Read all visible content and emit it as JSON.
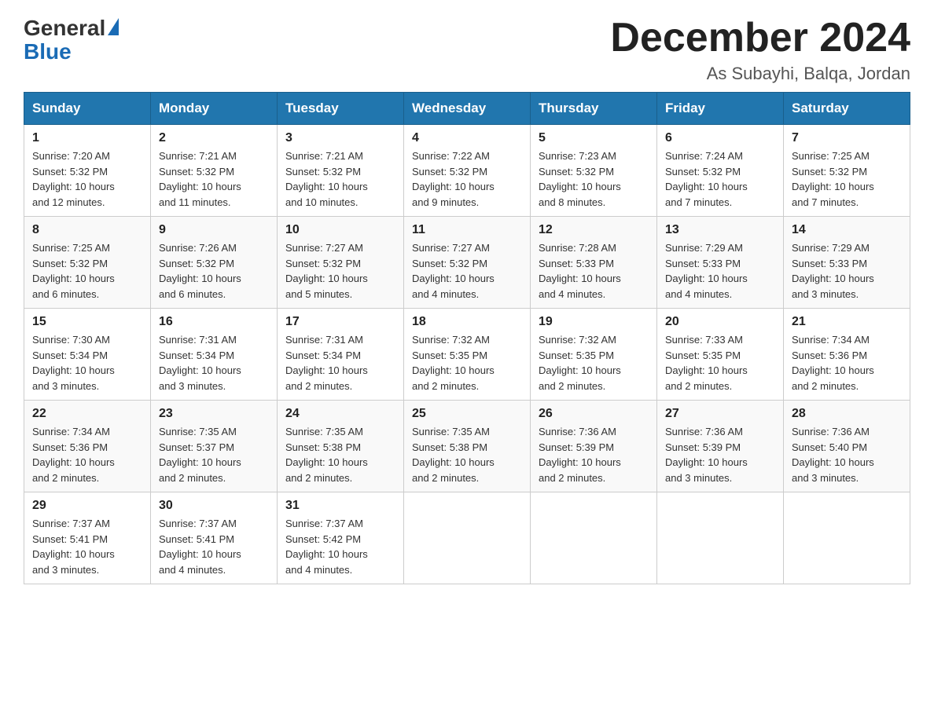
{
  "header": {
    "logo_general": "General",
    "logo_blue": "Blue",
    "month_title": "December 2024",
    "location": "As Subayhi, Balqa, Jordan"
  },
  "days_of_week": [
    "Sunday",
    "Monday",
    "Tuesday",
    "Wednesday",
    "Thursday",
    "Friday",
    "Saturday"
  ],
  "weeks": [
    [
      {
        "day": "1",
        "sunrise": "7:20 AM",
        "sunset": "5:32 PM",
        "daylight": "10 hours and 12 minutes."
      },
      {
        "day": "2",
        "sunrise": "7:21 AM",
        "sunset": "5:32 PM",
        "daylight": "10 hours and 11 minutes."
      },
      {
        "day": "3",
        "sunrise": "7:21 AM",
        "sunset": "5:32 PM",
        "daylight": "10 hours and 10 minutes."
      },
      {
        "day": "4",
        "sunrise": "7:22 AM",
        "sunset": "5:32 PM",
        "daylight": "10 hours and 9 minutes."
      },
      {
        "day": "5",
        "sunrise": "7:23 AM",
        "sunset": "5:32 PM",
        "daylight": "10 hours and 8 minutes."
      },
      {
        "day": "6",
        "sunrise": "7:24 AM",
        "sunset": "5:32 PM",
        "daylight": "10 hours and 7 minutes."
      },
      {
        "day": "7",
        "sunrise": "7:25 AM",
        "sunset": "5:32 PM",
        "daylight": "10 hours and 7 minutes."
      }
    ],
    [
      {
        "day": "8",
        "sunrise": "7:25 AM",
        "sunset": "5:32 PM",
        "daylight": "10 hours and 6 minutes."
      },
      {
        "day": "9",
        "sunrise": "7:26 AM",
        "sunset": "5:32 PM",
        "daylight": "10 hours and 6 minutes."
      },
      {
        "day": "10",
        "sunrise": "7:27 AM",
        "sunset": "5:32 PM",
        "daylight": "10 hours and 5 minutes."
      },
      {
        "day": "11",
        "sunrise": "7:27 AM",
        "sunset": "5:32 PM",
        "daylight": "10 hours and 4 minutes."
      },
      {
        "day": "12",
        "sunrise": "7:28 AM",
        "sunset": "5:33 PM",
        "daylight": "10 hours and 4 minutes."
      },
      {
        "day": "13",
        "sunrise": "7:29 AM",
        "sunset": "5:33 PM",
        "daylight": "10 hours and 4 minutes."
      },
      {
        "day": "14",
        "sunrise": "7:29 AM",
        "sunset": "5:33 PM",
        "daylight": "10 hours and 3 minutes."
      }
    ],
    [
      {
        "day": "15",
        "sunrise": "7:30 AM",
        "sunset": "5:34 PM",
        "daylight": "10 hours and 3 minutes."
      },
      {
        "day": "16",
        "sunrise": "7:31 AM",
        "sunset": "5:34 PM",
        "daylight": "10 hours and 3 minutes."
      },
      {
        "day": "17",
        "sunrise": "7:31 AM",
        "sunset": "5:34 PM",
        "daylight": "10 hours and 2 minutes."
      },
      {
        "day": "18",
        "sunrise": "7:32 AM",
        "sunset": "5:35 PM",
        "daylight": "10 hours and 2 minutes."
      },
      {
        "day": "19",
        "sunrise": "7:32 AM",
        "sunset": "5:35 PM",
        "daylight": "10 hours and 2 minutes."
      },
      {
        "day": "20",
        "sunrise": "7:33 AM",
        "sunset": "5:35 PM",
        "daylight": "10 hours and 2 minutes."
      },
      {
        "day": "21",
        "sunrise": "7:34 AM",
        "sunset": "5:36 PM",
        "daylight": "10 hours and 2 minutes."
      }
    ],
    [
      {
        "day": "22",
        "sunrise": "7:34 AM",
        "sunset": "5:36 PM",
        "daylight": "10 hours and 2 minutes."
      },
      {
        "day": "23",
        "sunrise": "7:35 AM",
        "sunset": "5:37 PM",
        "daylight": "10 hours and 2 minutes."
      },
      {
        "day": "24",
        "sunrise": "7:35 AM",
        "sunset": "5:38 PM",
        "daylight": "10 hours and 2 minutes."
      },
      {
        "day": "25",
        "sunrise": "7:35 AM",
        "sunset": "5:38 PM",
        "daylight": "10 hours and 2 minutes."
      },
      {
        "day": "26",
        "sunrise": "7:36 AM",
        "sunset": "5:39 PM",
        "daylight": "10 hours and 2 minutes."
      },
      {
        "day": "27",
        "sunrise": "7:36 AM",
        "sunset": "5:39 PM",
        "daylight": "10 hours and 3 minutes."
      },
      {
        "day": "28",
        "sunrise": "7:36 AM",
        "sunset": "5:40 PM",
        "daylight": "10 hours and 3 minutes."
      }
    ],
    [
      {
        "day": "29",
        "sunrise": "7:37 AM",
        "sunset": "5:41 PM",
        "daylight": "10 hours and 3 minutes."
      },
      {
        "day": "30",
        "sunrise": "7:37 AM",
        "sunset": "5:41 PM",
        "daylight": "10 hours and 4 minutes."
      },
      {
        "day": "31",
        "sunrise": "7:37 AM",
        "sunset": "5:42 PM",
        "daylight": "10 hours and 4 minutes."
      },
      null,
      null,
      null,
      null
    ]
  ],
  "labels": {
    "sunrise": "Sunrise:",
    "sunset": "Sunset:",
    "daylight": "Daylight:"
  }
}
